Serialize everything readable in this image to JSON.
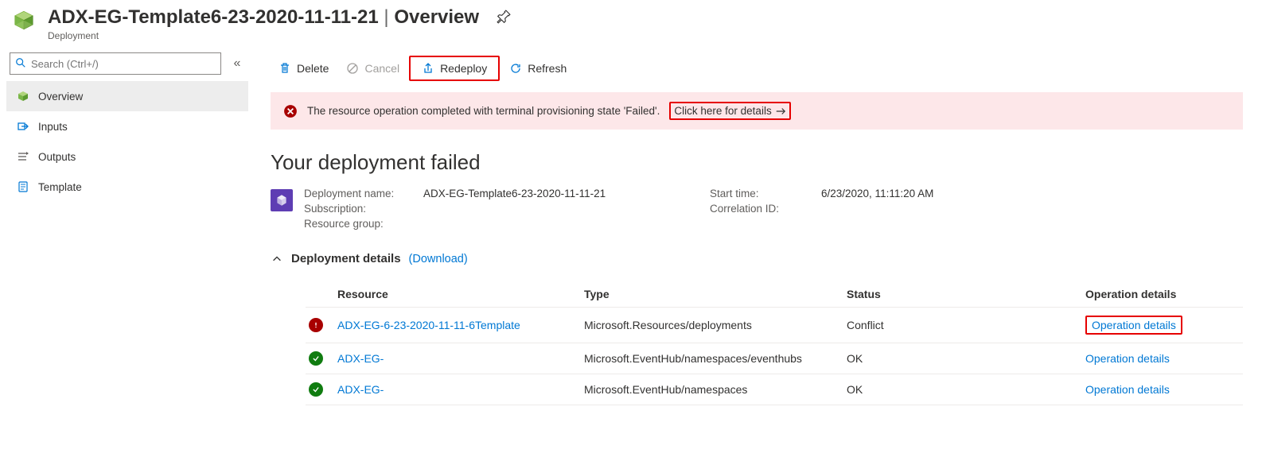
{
  "header": {
    "title_name": "ADX-EG-Template6-23-2020-11-11-21",
    "title_section": "Overview",
    "subtitle": "Deployment"
  },
  "search": {
    "placeholder": "Search (Ctrl+/)"
  },
  "sidebar": {
    "items": [
      {
        "label": "Overview"
      },
      {
        "label": "Inputs"
      },
      {
        "label": "Outputs"
      },
      {
        "label": "Template"
      }
    ]
  },
  "toolbar": {
    "delete": "Delete",
    "cancel": "Cancel",
    "redeploy": "Redeploy",
    "refresh": "Refresh"
  },
  "error": {
    "message": "The resource operation completed with terminal provisioning state 'Failed'.",
    "link": "Click here for details"
  },
  "heading": "Your deployment failed",
  "meta": {
    "dep_name_label": "Deployment name:",
    "dep_name_value": "ADX-EG-Template6-23-2020-11-11-21",
    "sub_label": "Subscription:",
    "sub_value": "",
    "rg_label": "Resource group:",
    "rg_value": "",
    "start_label": "Start time:",
    "start_value": "6/23/2020, 11:11:20 AM",
    "corr_label": "Correlation ID:",
    "corr_value": ""
  },
  "section": {
    "title": "Deployment details",
    "download": "(Download)"
  },
  "table": {
    "headers": {
      "resource": "Resource",
      "type": "Type",
      "status": "Status",
      "op": "Operation details"
    },
    "rows": [
      {
        "status": "error",
        "resource": "ADX-EG-6-23-2020-11-11-6Template",
        "type": "Microsoft.Resources/deployments",
        "status_text": "Conflict",
        "op": "Operation details",
        "op_highlight": true
      },
      {
        "status": "ok",
        "resource": "ADX-EG-",
        "type": "Microsoft.EventHub/namespaces/eventhubs",
        "status_text": "OK",
        "op": "Operation details",
        "op_highlight": false
      },
      {
        "status": "ok",
        "resource": "ADX-EG-",
        "type": "Microsoft.EventHub/namespaces",
        "status_text": "OK",
        "op": "Operation details",
        "op_highlight": false
      }
    ]
  }
}
